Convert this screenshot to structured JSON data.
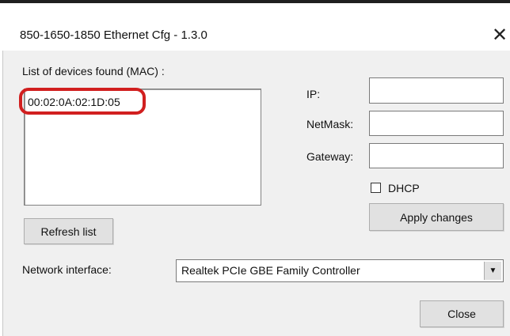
{
  "window": {
    "title": "850-1650-1850 Ethernet Cfg - 1.3.0",
    "close_glyph": "✕"
  },
  "devices": {
    "label": "List of devices found (MAC) :",
    "items": [
      "00:02:0A:02:1D:05"
    ],
    "highlight_color": "#d11f1f"
  },
  "buttons": {
    "refresh": "Refresh list",
    "apply": "Apply changes",
    "close": "Close"
  },
  "fields": {
    "ip_label": "IP:",
    "ip_value": "",
    "netmask_label": "NetMask:",
    "netmask_value": "",
    "gateway_label": "Gateway:",
    "gateway_value": "",
    "dhcp_label": "DHCP",
    "dhcp_checked": false
  },
  "network": {
    "label": "Network interface:",
    "selected": "Realtek PCIe GBE Family Controller",
    "arrow_glyph": "▼"
  },
  "icons": [
    "close-icon",
    "dropdown-arrow-icon"
  ]
}
